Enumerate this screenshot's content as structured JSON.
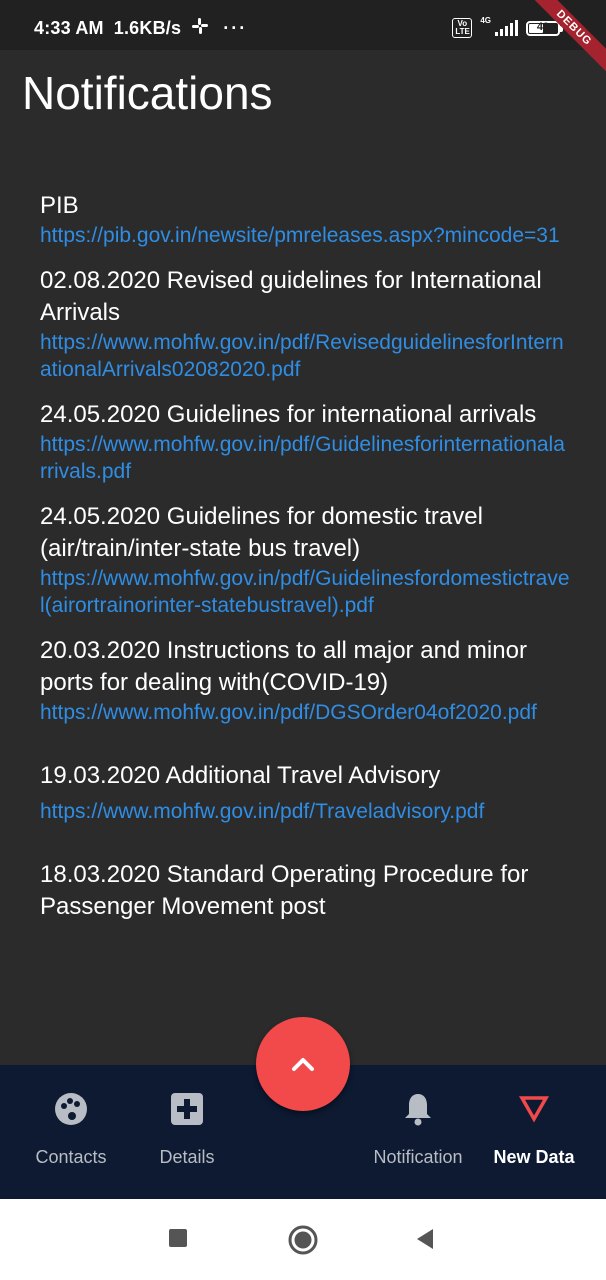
{
  "status_bar": {
    "time": "4:33 AM",
    "speed": "1.6KB/s",
    "more": "···",
    "volte": "Vo LTE",
    "network": "4G",
    "battery": "49",
    "debug_banner": "DEBUG"
  },
  "page": {
    "title": "Notifications"
  },
  "notifications": [
    {
      "title": "PIB",
      "link": "https://pib.gov.in/newsite/pmreleases.aspx?mincode=31"
    },
    {
      "title": "02.08.2020 Revised guidelines for International Arrivals",
      "link": "https://www.mohfw.gov.in/pdf/RevisedguidelinesforInternationalArrivals02082020.pdf"
    },
    {
      "title": "24.05.2020 Guidelines for international arrivals",
      "link": "https://www.mohfw.gov.in/pdf/Guidelinesforinternationalarrivals.pdf"
    },
    {
      "title": "24.05.2020 Guidelines for domestic travel (air/train/inter-state bus travel)",
      "link": "https://www.mohfw.gov.in/pdf/Guidelinesfordomestictravel(airortrainorinter-statebustravel).pdf"
    },
    {
      "title": "20.03.2020 Instructions to all major and minor ports for dealing with(COVID-19)",
      "link": "https://www.mohfw.gov.in/pdf/DGSOrder04of2020.pdf"
    },
    {
      "title": "19.03.2020 Additional Travel Advisory",
      "link": "https://www.mohfw.gov.in/pdf/Traveladvisory.pdf"
    },
    {
      "title": "18.03.2020 Standard Operating Procedure for Passenger Movement post",
      "link": ""
    }
  ],
  "fab": {
    "icon": "chevron-up-icon"
  },
  "bottom_nav": {
    "contacts": "Contacts",
    "details": "Details",
    "notification": "Notification",
    "new_data": "New Data"
  },
  "colors": {
    "background": "#2b2b2b",
    "link": "#2f8de4",
    "fab": "#f24a4a",
    "nav_bg": "#0d1a32",
    "new_data_accent": "#f24a4a"
  }
}
